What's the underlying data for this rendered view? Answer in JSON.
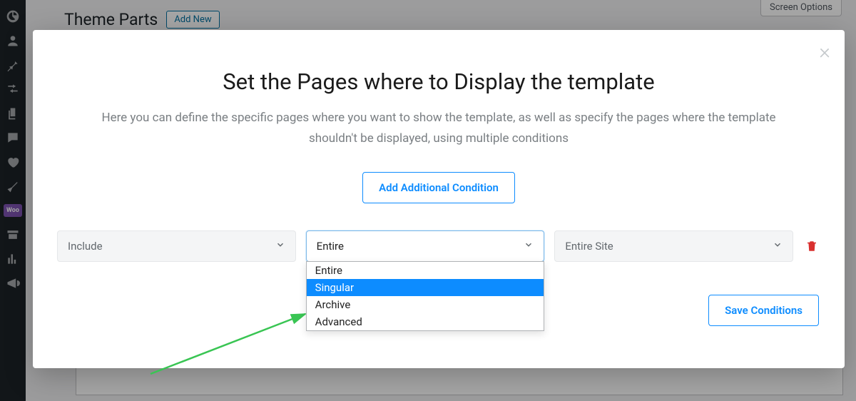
{
  "page": {
    "title": "Theme Parts",
    "add_new": "Add New",
    "screen_options": "Screen Options"
  },
  "sidebar_icons": [
    "dashboard-icon",
    "users-icon",
    "pin-icon",
    "settings-icon",
    "pages-icon",
    "comments-icon",
    "heart-icon",
    "tools-icon",
    "woocommerce-icon",
    "archive-icon",
    "analytics-icon",
    "marketing-icon"
  ],
  "modal": {
    "title": "Set the Pages where to Display the template",
    "description": "Here you can define the specific pages where you want to show the template, as well as specify the pages where the template shouldn't be displayed, using multiple conditions",
    "add_condition": "Add Additional Condition",
    "save": "Save Conditions",
    "close": "×"
  },
  "condition": {
    "mode_value": "Include",
    "type_value": "Entire",
    "type_options": [
      "Entire",
      "Singular",
      "Archive",
      "Advanced"
    ],
    "type_highlight_index": 1,
    "scope_value": "Entire Site"
  },
  "colors": {
    "accent": "#0d8cff",
    "danger": "#d9302f",
    "arrow": "#39c553"
  }
}
